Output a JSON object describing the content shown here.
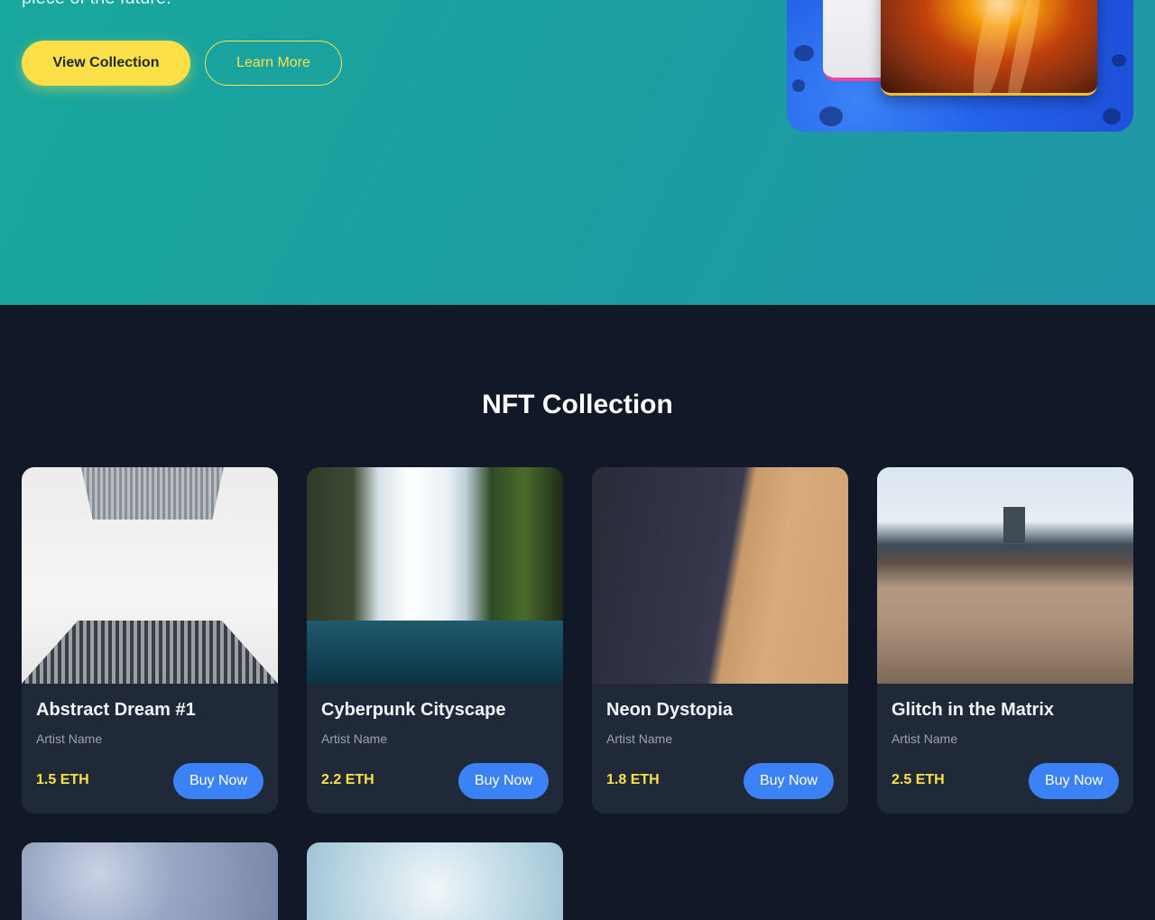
{
  "hero": {
    "subtitle": "piece of the future.",
    "primary_button": "View Collection",
    "secondary_button": "Learn More"
  },
  "collection": {
    "title": "NFT Collection",
    "items": [
      {
        "title": "Abstract Dream #1",
        "artist": "Artist Name",
        "price": "1.5 ETH",
        "button": "Buy Now"
      },
      {
        "title": "Cyberpunk Cityscape",
        "artist": "Artist Name",
        "price": "2.2 ETH",
        "button": "Buy Now"
      },
      {
        "title": "Neon Dystopia",
        "artist": "Artist Name",
        "price": "1.8 ETH",
        "button": "Buy Now"
      },
      {
        "title": "Glitch in the Matrix",
        "artist": "Artist Name",
        "price": "2.5 ETH",
        "button": "Buy Now"
      }
    ]
  },
  "colors": {
    "hero_bg": "#1b9ea0",
    "page_bg": "#111827",
    "card_bg": "#1f2937",
    "accent_yellow": "#fde047",
    "button_blue": "#3b82f6"
  }
}
